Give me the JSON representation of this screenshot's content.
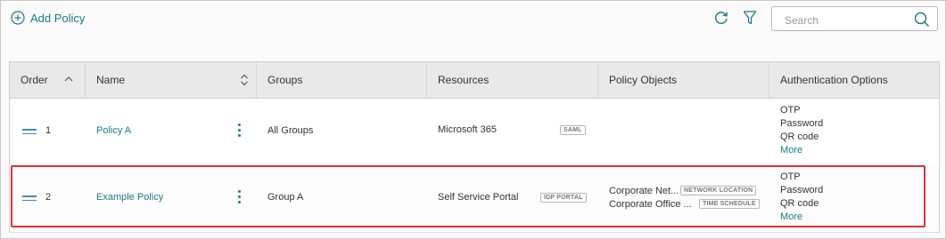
{
  "toolbar": {
    "add_label": "Add Policy",
    "search_placeholder": "Search"
  },
  "colors": {
    "accent": "#1a7a85",
    "highlight": "#e0323a",
    "header_bg": "#e9e9e9"
  },
  "table": {
    "columns": [
      "Order",
      "Name",
      "Groups",
      "Resources",
      "Policy Objects",
      "Authentication Options"
    ],
    "rows": [
      {
        "order": "1",
        "name": "Policy A",
        "groups": "All Groups",
        "resource": "Microsoft 365",
        "resource_badge": "SAML",
        "policy_objects": [],
        "auth": [
          "OTP",
          "Password",
          "QR code"
        ],
        "more": "More"
      },
      {
        "order": "2",
        "name": "Example Policy",
        "groups": "Group A",
        "resource": "Self Service Portal",
        "resource_badge": "IDP PORTAL",
        "policy_objects": [
          {
            "name": "Corporate Net...",
            "badge": "NETWORK LOCATION"
          },
          {
            "name": "Corporate Office ...",
            "badge": "TIME SCHEDULE"
          }
        ],
        "auth": [
          "OTP",
          "Password",
          "QR code"
        ],
        "more": "More"
      }
    ]
  }
}
